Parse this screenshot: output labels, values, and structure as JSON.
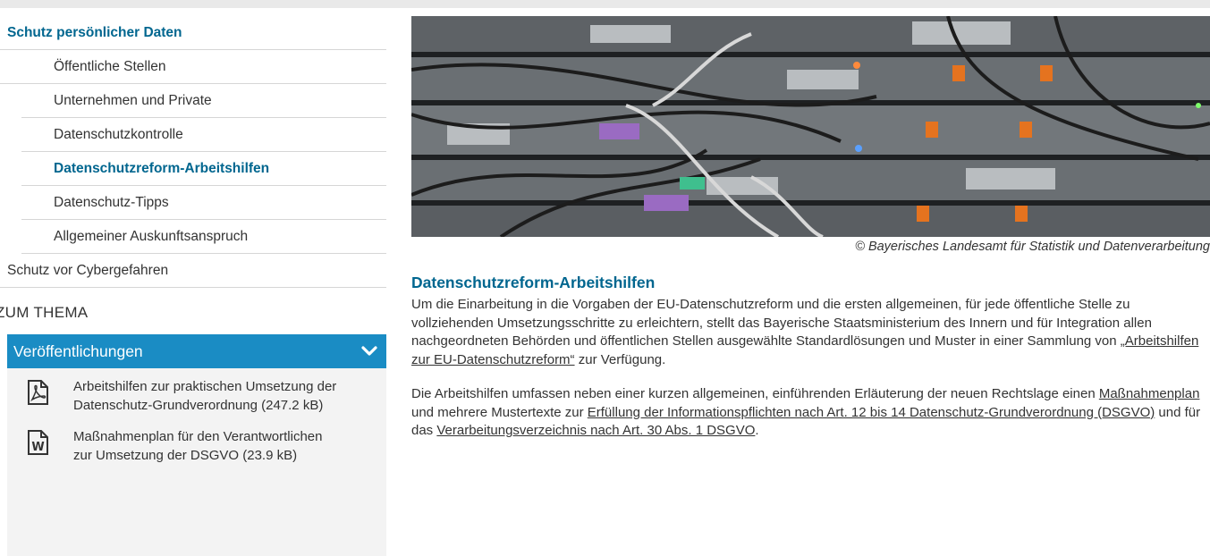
{
  "sidebar": {
    "nav": [
      {
        "label": "Schutz persönlicher Daten"
      },
      {
        "label": "Öffentliche Stellen"
      },
      {
        "label": "Unternehmen und Private"
      },
      {
        "label": "Datenschutzkontrolle"
      },
      {
        "label": "Datenschutzreform-Arbeitshilfen"
      },
      {
        "label": "Datenschutz-Tipps"
      },
      {
        "label": "Allgemeiner Auskunftsanspruch"
      },
      {
        "label": "Schutz vor Cybergefahren"
      }
    ],
    "zum_thema": "ZUM THEMA",
    "accordion_title": "Veröffentlichungen",
    "publications": [
      {
        "icon": "pdf-icon",
        "text": "Arbeitshilfen zur praktischen Umsetzung der Datenschutz-Grundverordnung (247.2 kB)"
      },
      {
        "icon": "word-icon",
        "text": "Maßnahmenplan für den Verantwortlichen zur Umsetzung der DSGVO (23.9 kB)"
      }
    ]
  },
  "main": {
    "image_caption": "© Bayerisches Landesamt für Statistik und Datenverarbeitung",
    "title": "Datenschutzreform-Arbeitshilfen",
    "para1_text": "Um die Einarbeitung in die Vorgaben der EU-Datenschutzreform und die ersten allgemeinen, für jede öffentliche Stelle zu vollziehenden Umsetzungsschritte zu erleichtern, stellt das Bayerische Staatsministerium des Innern und für Integration allen nachgeordneten Behörden und öffentlichen Stellen ausgewählte Standardlösungen und Muster in einer Sammlung von ",
    "para1_link": "„Arbeitshilfen zur EU-Datenschutzreform“",
    "para1_end": " zur Verfügung.",
    "para2_a": "Die Arbeitshilfen umfassen neben einer kurzen allgemeinen, einführenden Erläuterung der neuen Rechtslage einen ",
    "para2_link1": "Maßnahmenplan",
    "para2_b": " und mehrere Mustertexte zur ",
    "para2_link2": "Erfüllung der Informationspflichten nach Art. 12 bis 14 Datenschutz-Grundverordnung (DSGVO)",
    "para2_c": " und für das ",
    "para2_link3": "Verarbeitungsverzeichnis nach Art. 30 Abs. 1 DSGVO",
    "para2_d": "."
  },
  "colors": {
    "accent": "#00668f",
    "accordion": "#1a8cc4"
  }
}
